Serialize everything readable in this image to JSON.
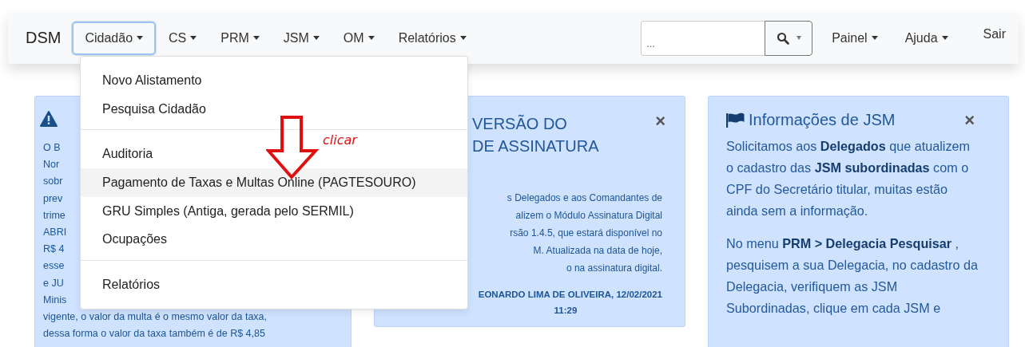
{
  "navbar": {
    "brand": "DSM",
    "menus": [
      {
        "label": "Cidadão",
        "selected": true
      },
      {
        "label": "CS",
        "selected": false
      },
      {
        "label": "PRM",
        "selected": false
      },
      {
        "label": "JSM",
        "selected": false
      },
      {
        "label": "OM",
        "selected": false
      },
      {
        "label": "Relatórios",
        "selected": false
      }
    ],
    "search": {
      "placeholder": "..."
    },
    "right_menus": [
      {
        "label": "Painel"
      },
      {
        "label": "Ajuda"
      }
    ],
    "logout": "Sair"
  },
  "dropdown": {
    "sections": [
      [
        {
          "label": "Novo Alistamento",
          "selected": false
        },
        {
          "label": "Pesquisa Cidadão",
          "selected": false
        }
      ],
      [
        {
          "label": "Auditoria",
          "selected": false
        },
        {
          "label": "Pagamento de Taxas e Multas Online (PAGTESOURO)",
          "selected": true
        },
        {
          "label": "GRU Simples (Antiga, gerada pelo SERMIL)",
          "selected": false
        },
        {
          "label": "Ocupações",
          "selected": false
        }
      ],
      [
        {
          "label": "Relatórios",
          "selected": false
        }
      ]
    ]
  },
  "annotation": {
    "label": "clicar"
  },
  "cards": [
    {
      "kind": "warning",
      "lines": [
        "O B",
        "Nor",
        "sobr",
        "prev",
        "trime",
        "ABRI",
        "R$ 4",
        "esse",
        "e JU",
        "Minis",
        "vigente, o valor da multa é o mesmo valor da taxa,",
        "dessa forma o valor da taxa também é de R$ 4,85"
      ]
    },
    {
      "kind": "notice",
      "title_lines": [
        "VERSÃO DO",
        "DE ASSINATURA"
      ],
      "lines": [
        "s Delegados e aos Comandantes de",
        "alizem o Módulo Assinatura Digital",
        "rsão 1.4.5, que estará disponível no",
        "M. Atualizada na data de hoje,",
        "o na assinatura digital."
      ],
      "signature": [
        "EONARDO LIMA DE OLIVEIRA, 12/02/2021",
        "11:29"
      ],
      "close": "×"
    },
    {
      "kind": "flag",
      "title": "Informações de JSM",
      "paragraphs": [
        "Solicitamos aos **Delegados** que atualizem o cadastro das **JSM subordinadas** com o CPF do Secretário titular, muitas estão ainda sem a informação.",
        "No menu **PRM > Delegacia Pesquisar** , pesquisem a sua Delegacia, no cadastro da Delegacia, verifiquem as JSM Subordinadas, clique em cada JSM e"
      ],
      "close": "×"
    }
  ]
}
